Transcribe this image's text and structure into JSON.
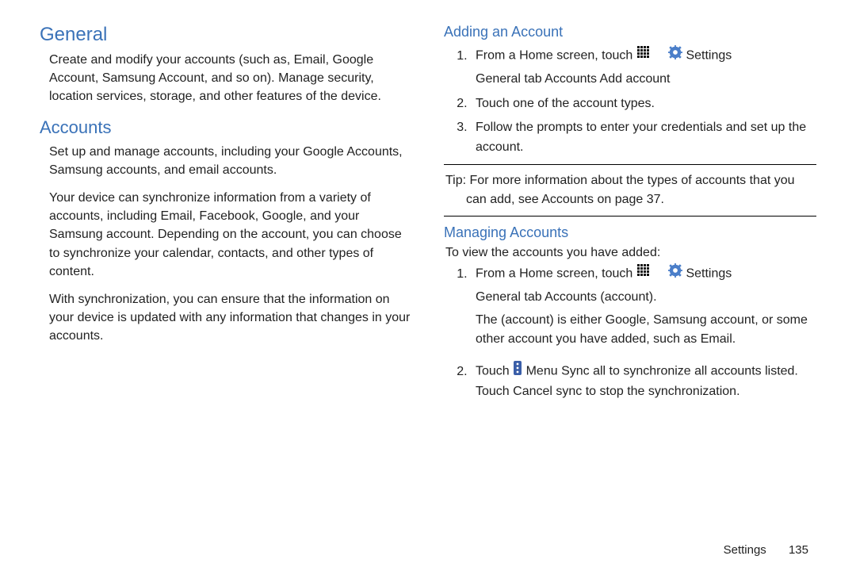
{
  "left": {
    "general_heading": "General",
    "general_body": "Create and modify your accounts (such as, Email, Google Account, Samsung Account, and so on). Manage security, location services, storage, and other features of the device.",
    "accounts_heading": "Accounts",
    "accounts_p1": "Set up and manage accounts, including your Google Accounts, Samsung accounts, and email accounts.",
    "accounts_p2": "Your device can synchronize information from a variety of accounts, including Email, Facebook, Google, and your Samsung account. Depending on the account, you can choose to synchronize your calendar, contacts, and other types of content.",
    "accounts_p3": "With synchronization, you can ensure that the information on your device is updated with any information that changes in your accounts."
  },
  "right": {
    "adding_heading": "Adding an Account",
    "adding_step1_a": "From a Home screen, touch ",
    "adding_step1_b": " Settings ",
    "adding_step1_line2": "General tab    Accounts    Add account",
    "adding_step2": "Touch one of the account types.",
    "adding_step3": "Follow the prompts to enter your credentials and set up the account.",
    "tip_label": "Tip:",
    "tip_body_1": "For more information about the types of accounts that you",
    "tip_body_2": "can add, see  Accounts on page 37.",
    "managing_heading": "Managing Accounts",
    "managing_intro": "To view the accounts you have added:",
    "managing_step1_a": "From a Home screen, touch ",
    "managing_step1_b": " Settings ",
    "managing_step1_line2": "General tab    Accounts    (account).",
    "managing_step1_explain": "The (account) is either Google, Samsung account, or some other account you have added, such as Email.",
    "managing_step2_a": "Touch ",
    "managing_step2_b": " Menu    Sync all to synchronize all accounts listed. Touch Cancel sync to stop the synchronization."
  },
  "footer": {
    "section": "Settings",
    "page": "135"
  },
  "icons": {
    "apps": "apps-grid-icon",
    "settings": "settings-gear-icon",
    "menu": "menu-dots-icon"
  }
}
